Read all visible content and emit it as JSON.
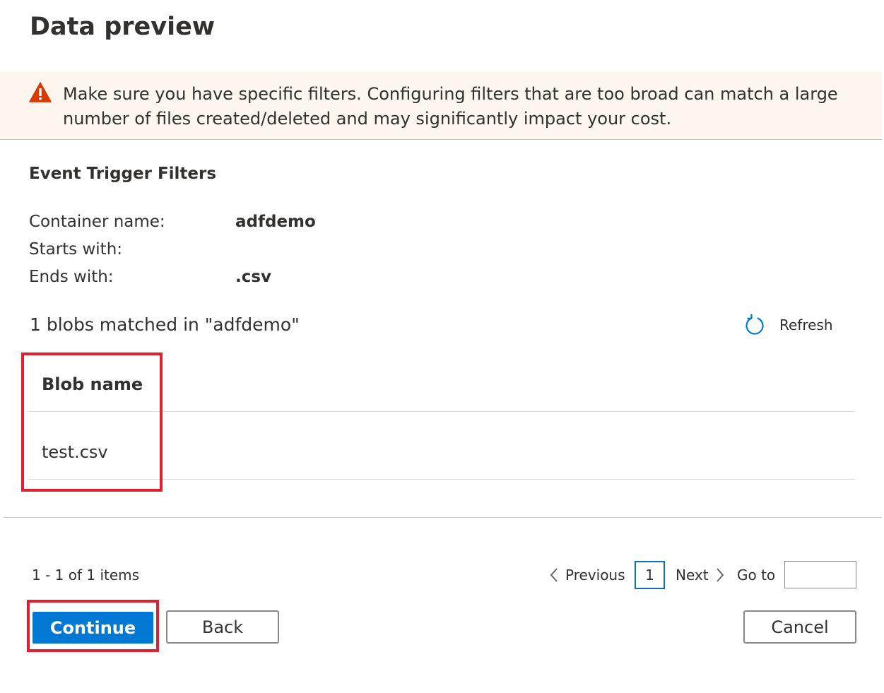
{
  "page": {
    "title": "Data preview"
  },
  "warning": {
    "icon": "warning-icon",
    "color": "#d83b01",
    "text": "Make sure you have specific filters. Configuring filters that are too broad can match a large number of files created/deleted and may significantly impact your cost."
  },
  "filters": {
    "title": "Event Trigger Filters",
    "container_label": "Container name:",
    "container_value": "adfdemo",
    "starts_label": "Starts with:",
    "starts_value": "",
    "ends_label": "Ends with:",
    "ends_value": ".csv"
  },
  "results": {
    "match_text": "1 blobs matched in \"adfdemo\"",
    "refresh_label": "Refresh",
    "refresh_icon": "refresh-icon"
  },
  "table": {
    "column": "Blob name",
    "rows": [
      "test.csv"
    ]
  },
  "pagination": {
    "items_text": "1 - 1 of 1 items",
    "previous": "Previous",
    "current_page": "1",
    "next": "Next",
    "goto_label": "Go to",
    "goto_value": ""
  },
  "buttons": {
    "continue": "Continue",
    "back": "Back",
    "cancel": "Cancel"
  },
  "colors": {
    "accent": "#0078d4",
    "highlight": "#e0202e",
    "warning_bg": "#fdf6ef"
  }
}
